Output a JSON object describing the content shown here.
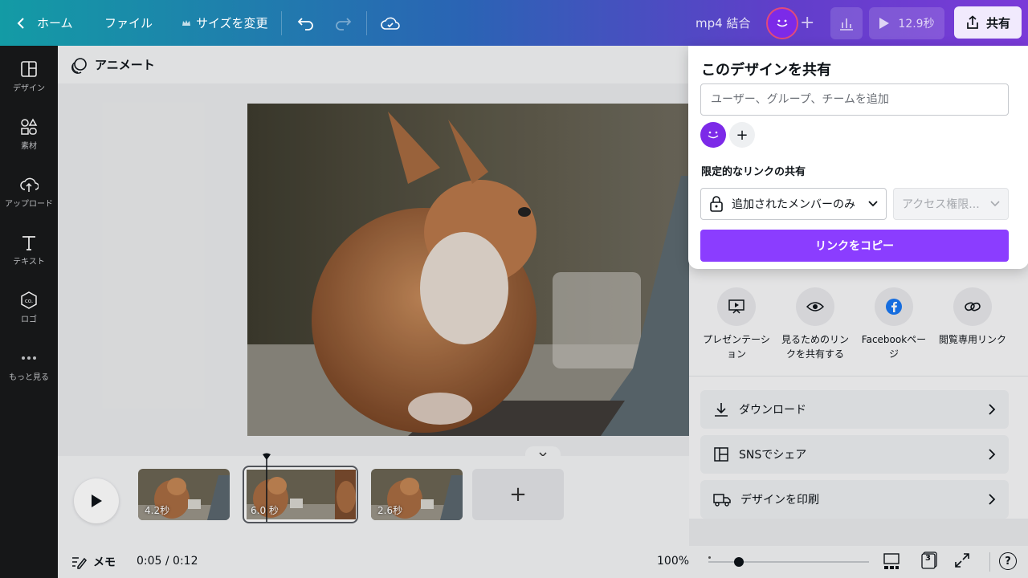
{
  "topbar": {
    "home": "ホーム",
    "file": "ファイル",
    "resize": "サイズを変更",
    "title": "mp4 結合",
    "duration": "12.9秒",
    "share": "共有"
  },
  "sidebar": {
    "items": [
      {
        "label": "デザイン",
        "icon": "design-icon"
      },
      {
        "label": "素材",
        "icon": "elements-icon"
      },
      {
        "label": "アップロード",
        "icon": "upload-icon"
      },
      {
        "label": "テキスト",
        "icon": "text-icon"
      },
      {
        "label": "ロゴ",
        "icon": "logo-icon"
      },
      {
        "label": "もっと見る",
        "icon": "more-icon"
      }
    ]
  },
  "canvas": {
    "animate_label": "アニメート"
  },
  "timeline": {
    "clips": [
      {
        "duration": "4.2秒"
      },
      {
        "duration": "6.0 秒"
      },
      {
        "duration": "2.6秒"
      }
    ]
  },
  "bottombar": {
    "notes": "メモ",
    "time": "0:05 / 0:12",
    "zoom": "100%",
    "pages": "3"
  },
  "share_panel": {
    "title": "このデザインを共有",
    "input_placeholder": "ユーザー、グループ、チームを追加",
    "section_label": "限定的なリンクの共有",
    "access_select": "追加されたメンバーのみ",
    "permission_select": "アクセス権限...",
    "copy_button": "リンクをコピー"
  },
  "right_panel": {
    "options": [
      {
        "label": "プレゼンテーション",
        "icon": "present-icon"
      },
      {
        "label": "見るためのリンクを共有する",
        "icon": "eye-icon"
      },
      {
        "label": "Facebookページ",
        "icon": "facebook-icon"
      },
      {
        "label": "閲覧専用リンク",
        "icon": "link-icon"
      }
    ],
    "rows": [
      {
        "label": "ダウンロード",
        "icon": "download-icon"
      },
      {
        "label": "SNSでシェア",
        "icon": "social-share-icon"
      },
      {
        "label": "デザインを印刷",
        "icon": "print-truck-icon"
      }
    ]
  },
  "colors": {
    "accent": "#8b3dff",
    "avatar": "#7c2ae8",
    "sidebar_bg": "#18191b"
  }
}
